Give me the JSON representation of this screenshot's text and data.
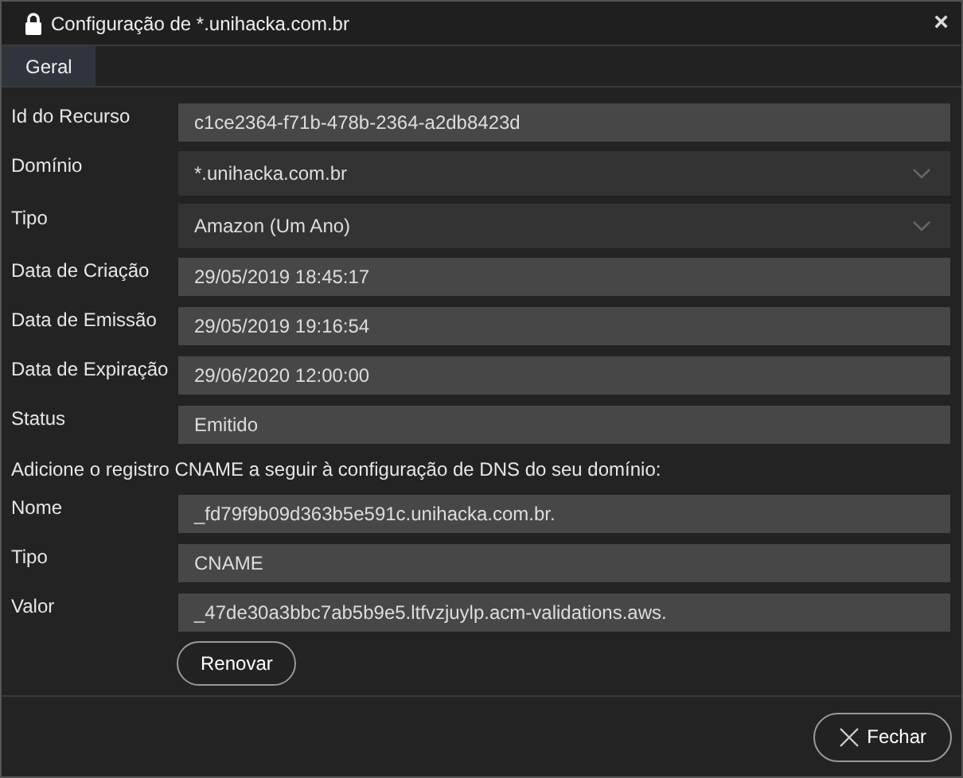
{
  "window": {
    "title": "Configuração de *.unihacka.com.br",
    "close": "×"
  },
  "tabs": [
    {
      "label": "Geral",
      "selected": true
    }
  ],
  "fields": [
    {
      "label": "Id do Recurso",
      "value": "c1ce2364-f71b-478b-2364-a2db8423d",
      "kind": "text"
    },
    {
      "label": "Domínio",
      "value": "*.unihacka.com.br",
      "kind": "select"
    },
    {
      "label": "Tipo",
      "value": "Amazon (Um Ano)",
      "kind": "select"
    },
    {
      "label": "Data de Criação",
      "value": "29/05/2019 18:45:17",
      "kind": "text"
    },
    {
      "label": "Data de Emissão",
      "value": "29/05/2019 19:16:54",
      "kind": "text"
    },
    {
      "label": "Data de Expiração",
      "value": "29/06/2020 12:00:00",
      "kind": "text"
    },
    {
      "label": "Status",
      "value": "Emitido",
      "kind": "text"
    }
  ],
  "note": "Adicione o registro CNAME a seguir à configuração de DNS do seu domínio:",
  "dns_fields": [
    {
      "label": "Nome",
      "value": "_fd79f9b09d363b5e591c.unihacka.com.br.",
      "kind": "text"
    },
    {
      "label": "Tipo",
      "value": "CNAME",
      "kind": "text"
    },
    {
      "label": "Valor",
      "value": "_47de30a3bbc7ab5b9e5.ltfvzjuylp.acm-validations.aws.",
      "kind": "text"
    }
  ],
  "renew_button": "Renovar",
  "close_button": "Fechar"
}
